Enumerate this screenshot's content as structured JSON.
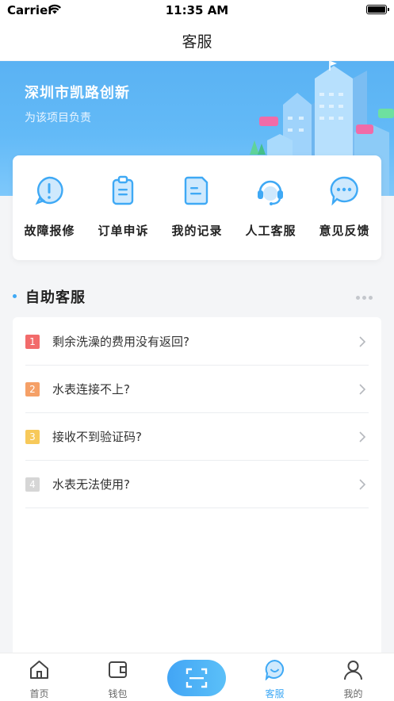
{
  "status_bar": {
    "carrier": "Carrier",
    "time": "11:35 AM"
  },
  "nav": {
    "title": "客服"
  },
  "banner": {
    "title": "深圳市凯路创新",
    "subtitle": "为该项目负责"
  },
  "quick_actions": [
    {
      "label": "故障报修",
      "icon": "alert-bubble-icon"
    },
    {
      "label": "订单申诉",
      "icon": "clipboard-icon"
    },
    {
      "label": "我的记录",
      "icon": "document-icon"
    },
    {
      "label": "人工客服",
      "icon": "headset-icon"
    },
    {
      "label": "意见反馈",
      "icon": "chat-bubble-icon"
    }
  ],
  "section": {
    "title": "自助客服"
  },
  "faq": [
    {
      "num": "1",
      "text": "剩余洗澡的费用没有返回?",
      "color": "#f26b6b"
    },
    {
      "num": "2",
      "text": "水表连接不上?",
      "color": "#f5a067"
    },
    {
      "num": "3",
      "text": "接收不到验证码?",
      "color": "#f7c95a"
    },
    {
      "num": "4",
      "text": "水表无法使用?",
      "color": "#d6d6d6"
    }
  ],
  "tabs": [
    {
      "label": "首页",
      "icon": "home-icon"
    },
    {
      "label": "钱包",
      "icon": "wallet-icon"
    },
    {
      "label": "",
      "icon": "scan-icon"
    },
    {
      "label": "客服",
      "icon": "service-smile-icon"
    },
    {
      "label": "我的",
      "icon": "user-icon"
    }
  ],
  "colors": {
    "accent": "#3fa9f5",
    "banner": "#5ab2f3"
  }
}
